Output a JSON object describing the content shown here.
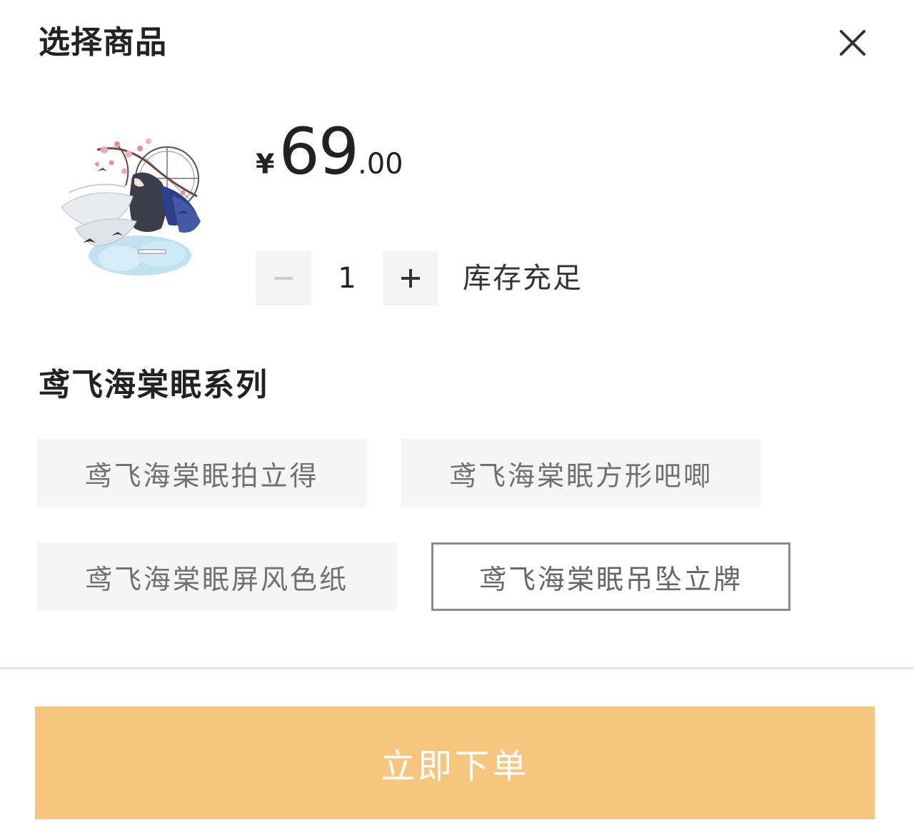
{
  "header": {
    "title": "选择商品",
    "close_icon": "close-icon"
  },
  "product": {
    "image_icon": "product-image",
    "price": {
      "currency": "¥",
      "integer": "69",
      "decimal": ".00"
    },
    "quantity": {
      "minus_icon": "minus-icon",
      "value": "1",
      "plus_icon": "plus-icon"
    },
    "stock_status": "库存充足"
  },
  "series": {
    "title": "鸢飞海棠眠系列",
    "options": [
      {
        "label": "鸢飞海棠眠拍立得",
        "selected": false
      },
      {
        "label": "鸢飞海棠眠方形吧唧",
        "selected": false
      },
      {
        "label": "鸢飞海棠眠屏风色纸",
        "selected": false
      },
      {
        "label": "鸢飞海棠眠吊坠立牌",
        "selected": true
      }
    ]
  },
  "footer": {
    "order_label": "立即下单"
  },
  "colors": {
    "order_button_bg": "#f7c67e",
    "option_bg": "#f5f5f5",
    "selected_border": "#8a8a8a"
  }
}
